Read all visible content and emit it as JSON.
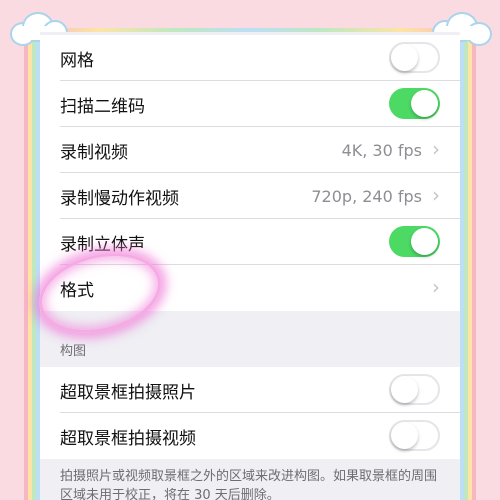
{
  "settings_top": [
    {
      "label": "网格",
      "control": "toggle",
      "state": "off"
    },
    {
      "label": "扫描二维码",
      "control": "toggle",
      "state": "on"
    },
    {
      "label": "录制视频",
      "control": "link",
      "value": "4K, 30 fps"
    },
    {
      "label": "录制慢动作视频",
      "control": "link",
      "value": "720p, 240 fps"
    },
    {
      "label": "录制立体声",
      "control": "toggle",
      "state": "on"
    },
    {
      "label": "格式",
      "control": "link",
      "value": ""
    }
  ],
  "composition_section": {
    "header": "构图",
    "items": [
      {
        "label": "超取景框拍摄照片",
        "control": "toggle",
        "state": "off"
      },
      {
        "label": "超取景框拍摄视频",
        "control": "toggle",
        "state": "off"
      }
    ],
    "footer": "拍摄照片或视频取景框之外的区域来改进构图。如果取景框的周围区域未用于校正，将在 30 天后删除。"
  },
  "colors": {
    "background": "#fadbe2",
    "toggle_on": "#4cd964",
    "highlight": "#f078d7",
    "cloud_outline": "#a9d4ec"
  },
  "icons": {
    "chevron": "chevron-right-icon"
  }
}
